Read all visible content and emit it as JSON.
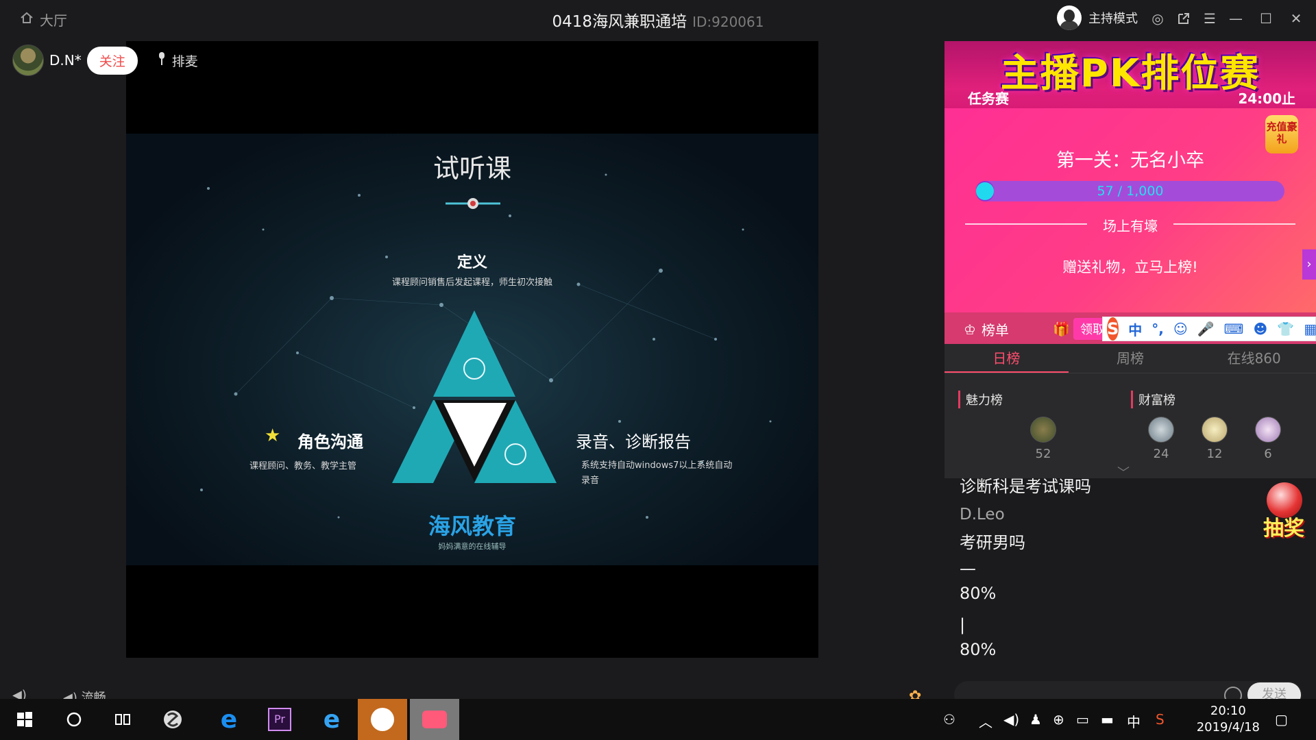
{
  "titlebar": {
    "lobby": "大厅",
    "room_title": "0418海风兼职通培",
    "room_id": "ID:920061",
    "host_mode": "主持模式"
  },
  "streamer": {
    "name": "D.N*",
    "follow": "关注",
    "mic_queue": "排麦"
  },
  "slide": {
    "title": "试听课",
    "def_title": "定义",
    "def_desc": "课程顾问销售后发起课程，师生初次接触",
    "left_label": "角色沟通",
    "left_desc": "课程顾问、教务、教学主管",
    "right_label": "录音、诊断报告",
    "right_desc": "系统支持自动windows7以上系统自动录音",
    "logo": "海风教育",
    "logo_sub": "妈妈满意的在线辅导"
  },
  "pk": {
    "title": "主播PK排位赛",
    "left": "任务赛",
    "right": "24:00止",
    "recharge": "充值豪礼",
    "stage": "第一关：无名小卒",
    "progress_current": 57,
    "progress_max": 1000,
    "progress_text": "57 / 1,000",
    "hero": "场上有壕",
    "gift_msg": "赠送礼物，立马上榜!",
    "rank_tab": "榜单",
    "claim": "领取"
  },
  "ime": {
    "logo": "S",
    "mode": "中",
    "punct": "°,"
  },
  "ranking": {
    "tabs": [
      "日榜",
      "周榜",
      "在线860"
    ],
    "charm_label": "魅力榜",
    "wealth_label": "财富榜",
    "charm": [
      {
        "value": "52"
      }
    ],
    "wealth": [
      {
        "value": "24"
      },
      {
        "value": "12"
      },
      {
        "value": "6"
      }
    ]
  },
  "chat": {
    "line1": "诊断科是考试课吗",
    "name2": "D.Leo",
    "line2": "考研男吗",
    "line3": "—",
    "line4": "80%",
    "line5": "|",
    "line6": "80%",
    "send": "发送",
    "lottery": "抽奖"
  },
  "bottom": {
    "smooth": "流畅"
  },
  "taskbar": {
    "time": "20:10",
    "date": "2019/4/18",
    "ime_tray": "中"
  },
  "colors": {
    "accent_pink": "#ff4d6d",
    "pk_pink": "#ff2f94",
    "follow_red": "#f04a4a"
  }
}
